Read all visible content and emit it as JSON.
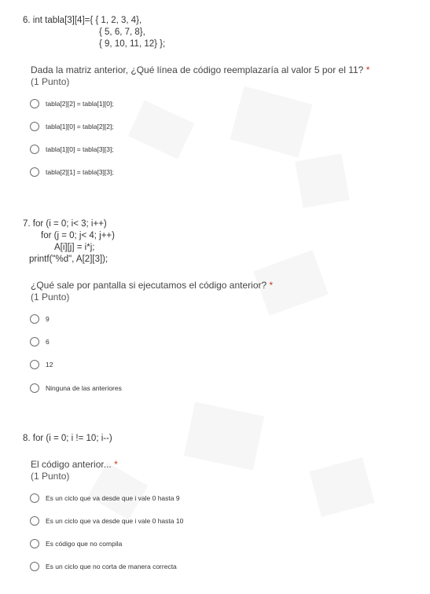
{
  "questions": [
    {
      "code": [
        "6. int tabla[3][4]={ { 1, 2, 3, 4},",
        "{ 5, 6, 7, 8},",
        "{ 9, 10, 11, 12} };"
      ],
      "prompt": "Dada la matriz anterior, ¿Qué línea de código reemplazaría al valor 5 por el 11?",
      "required": "*",
      "points": "(1 Punto)",
      "options": [
        "tabla[2][2] = tabla[1][0];",
        "tabla[1][0] = tabla[2][2];",
        "tabla[1][0] = tabla[3][3];",
        "tabla[2][1] = tabla[3][3];"
      ]
    },
    {
      "code": [
        "7. for (i = 0; i< 3; i++)",
        "for (j = 0; j< 4; j++)",
        "A[i][j] = i*j;",
        "printf(\"%d\", A[2][3]);"
      ],
      "prompt": "¿Qué sale por pantalla si ejecutamos el código anterior?",
      "required": "*",
      "points": "(1 Punto)",
      "options": [
        "9",
        "6",
        "12",
        "Ninguna de las anteriores"
      ]
    },
    {
      "code": [
        "8. for (i = 0; i != 10; i--)"
      ],
      "prompt": "El código anterior...",
      "required": "*",
      "points": "(1 Punto)",
      "options": [
        "Es un ciclo que va desde que i vale 0 hasta 9",
        "Es un ciclo que va desde que i vale 0 hasta 10",
        "Es código que no compila",
        "Es un ciclo que no corta de manera correcta"
      ]
    }
  ]
}
